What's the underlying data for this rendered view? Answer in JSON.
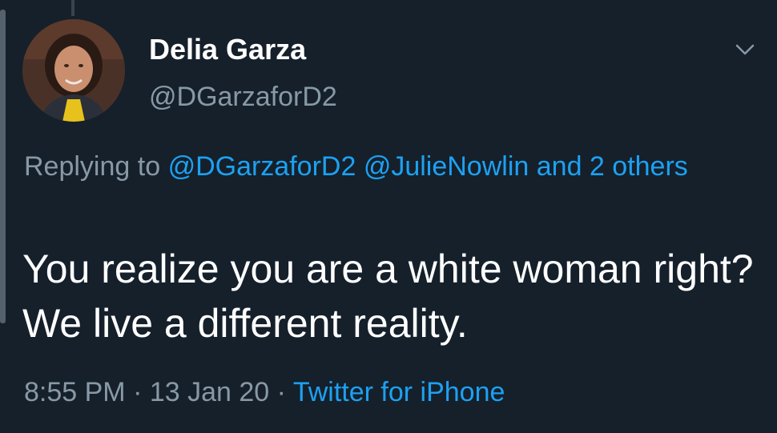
{
  "tweet": {
    "author": {
      "name": "Delia Garza",
      "handle": "@DGarzaforD2"
    },
    "reply": {
      "prefix": "Replying to",
      "mention_1": "@DGarzaforD2",
      "mention_2": "@JulieNowlin",
      "and_others": "and 2 others"
    },
    "text": "You realize you are a white woman right? We live a different reality.",
    "time": "8:55 PM",
    "separator_1": "·",
    "date": "13 Jan 20",
    "separator_2": "·",
    "source": "Twitter for iPhone"
  },
  "icons": {
    "menu": "chevron-down-icon",
    "avatar": "avatar"
  },
  "colors": {
    "background": "#15202b",
    "text_primary": "#ffffff",
    "text_secondary": "#8899a6",
    "accent": "#1da1f2"
  }
}
